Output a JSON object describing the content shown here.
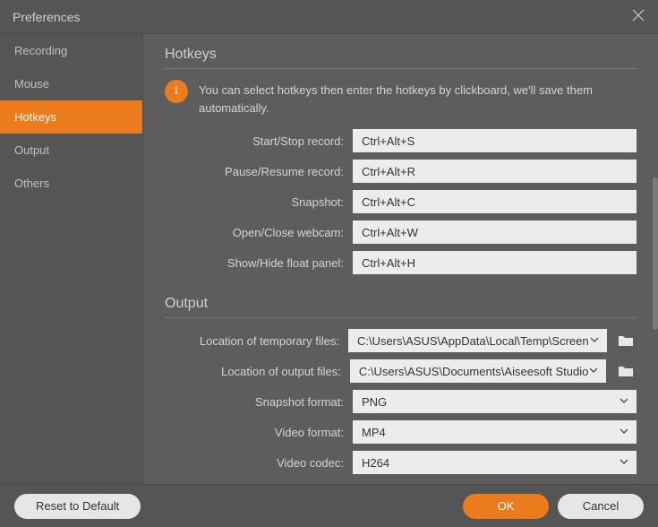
{
  "window": {
    "title": "Preferences"
  },
  "sidebar": {
    "items": [
      {
        "label": "Recording"
      },
      {
        "label": "Mouse"
      },
      {
        "label": "Hotkeys",
        "active": true
      },
      {
        "label": "Output"
      },
      {
        "label": "Others"
      }
    ]
  },
  "sections": {
    "hotkeys": {
      "title": "Hotkeys",
      "info_badge": "i",
      "info_text": "You can select hotkeys then enter the hotkeys by clickboard, we'll save them automatically.",
      "rows": [
        {
          "label": "Start/Stop record:",
          "value": "Ctrl+Alt+S"
        },
        {
          "label": "Pause/Resume record:",
          "value": "Ctrl+Alt+R"
        },
        {
          "label": "Snapshot:",
          "value": "Ctrl+Alt+C"
        },
        {
          "label": "Open/Close webcam:",
          "value": "Ctrl+Alt+W"
        },
        {
          "label": "Show/Hide float panel:",
          "value": "Ctrl+Alt+H"
        }
      ]
    },
    "output": {
      "title": "Output",
      "rows": [
        {
          "label": "Location of temporary files:",
          "value": "C:\\Users\\ASUS\\AppData\\Local\\Temp\\Screen",
          "type": "path"
        },
        {
          "label": "Location of output files:",
          "value": "C:\\Users\\ASUS\\Documents\\Aiseesoft Studio",
          "type": "path"
        },
        {
          "label": "Snapshot format:",
          "value": "PNG",
          "type": "select"
        },
        {
          "label": "Video format:",
          "value": "MP4",
          "type": "select"
        },
        {
          "label": "Video codec:",
          "value": "H264",
          "type": "select"
        }
      ]
    }
  },
  "footer": {
    "reset": "Reset to Default",
    "ok": "OK",
    "cancel": "Cancel"
  }
}
